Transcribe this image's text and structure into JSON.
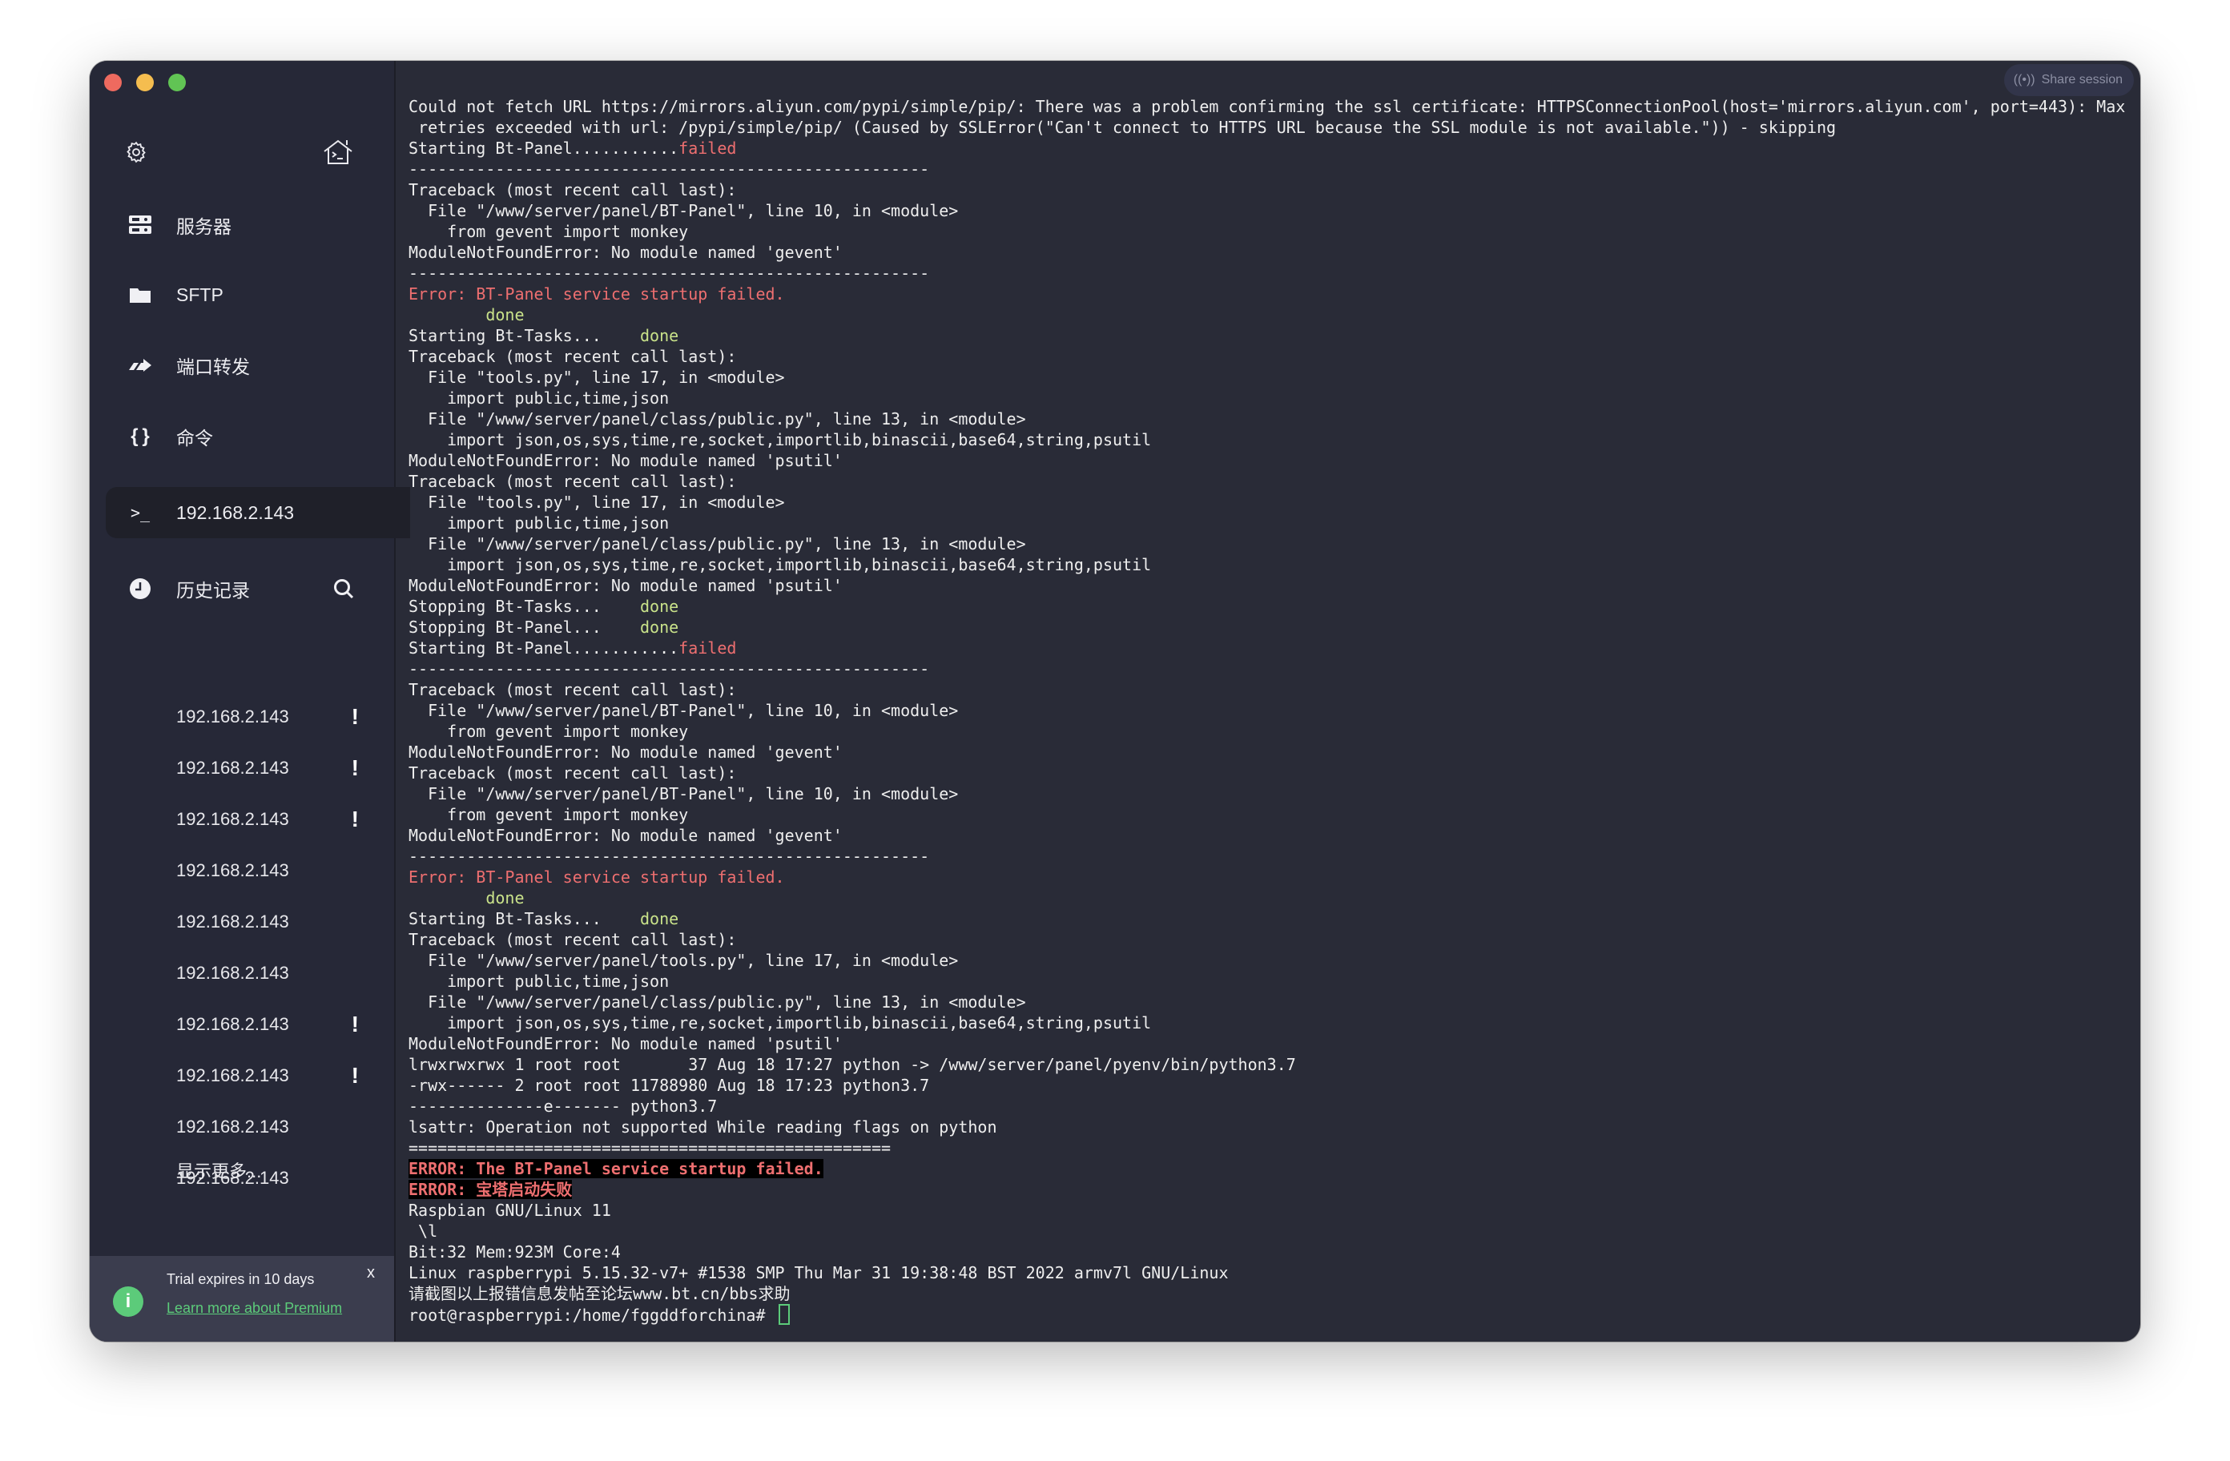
{
  "sidebar": {
    "nav": [
      {
        "label": "服务器",
        "icon": "server-icon"
      },
      {
        "label": "SFTP",
        "icon": "folder-icon"
      },
      {
        "label": "端口转发",
        "icon": "port-forward-icon"
      },
      {
        "label": "命令",
        "icon": "braces-icon"
      }
    ],
    "active_session": {
      "label": "192.168.2.143",
      "icon": "terminal-prompt-icon"
    },
    "history_label": "历史记录",
    "history": [
      {
        "label": "192.168.2.143",
        "warning": "!"
      },
      {
        "label": "192.168.2.143",
        "warning": "!"
      },
      {
        "label": "192.168.2.143",
        "warning": "!"
      },
      {
        "label": "192.168.2.143",
        "warning": ""
      },
      {
        "label": "192.168.2.143",
        "warning": ""
      },
      {
        "label": "192.168.2.143",
        "warning": ""
      },
      {
        "label": "192.168.2.143",
        "warning": "!"
      },
      {
        "label": "192.168.2.143",
        "warning": "!"
      },
      {
        "label": "192.168.2.143",
        "warning": ""
      },
      {
        "label": "192.168.2.143",
        "warning": ""
      }
    ],
    "show_more": "显示更多...",
    "trial": {
      "text": "Trial expires in 10 days",
      "link": "Learn more about Premium",
      "close": "x",
      "info": "i"
    }
  },
  "header": {
    "share_session": "Share session"
  },
  "colors": {
    "failed": "#ee6f70",
    "done": "#c9e28a",
    "accent": "#5ccb7a"
  },
  "terminal": {
    "lines": [
      [
        {
          "t": "Could not fetch URL https://mirrors.aliyun.com/pypi/simple/pip/: There was a problem confirming the ssl certificate: HTTPSConnectionPool(host='mirrors.aliyun.com', port=443): Max"
        }
      ],
      [
        {
          "t": " retries exceeded with url: /pypi/simple/pip/ (Caused by SSLError(\"Can't connect to HTTPS URL because the SSL module is not available.\")) - skipping"
        }
      ],
      [
        {
          "t": "Starting Bt-Panel..........."
        },
        {
          "t": "failed",
          "s": "red"
        }
      ],
      [
        {
          "t": "------------------------------------------------------"
        }
      ],
      [
        {
          "t": "Traceback (most recent call last):"
        }
      ],
      [
        {
          "t": "  File \"/www/server/panel/BT-Panel\", line 10, in <module>"
        }
      ],
      [
        {
          "t": "    from gevent import monkey"
        }
      ],
      [
        {
          "t": "ModuleNotFoundError: No module named 'gevent'"
        }
      ],
      [
        {
          "t": "------------------------------------------------------"
        }
      ],
      [
        {
          "t": "Error: BT-Panel service startup failed.",
          "s": "red"
        }
      ],
      [
        {
          "t": "        "
        },
        {
          "t": "done",
          "s": "green"
        }
      ],
      [
        {
          "t": "Starting Bt-Tasks...    "
        },
        {
          "t": "done",
          "s": "green"
        }
      ],
      [
        {
          "t": "Traceback (most recent call last):"
        }
      ],
      [
        {
          "t": "  File \"tools.py\", line 17, in <module>"
        }
      ],
      [
        {
          "t": "    import public,time,json"
        }
      ],
      [
        {
          "t": "  File \"/www/server/panel/class/public.py\", line 13, in <module>"
        }
      ],
      [
        {
          "t": "    import json,os,sys,time,re,socket,importlib,binascii,base64,string,psutil"
        }
      ],
      [
        {
          "t": "ModuleNotFoundError: No module named 'psutil'"
        }
      ],
      [
        {
          "t": "Traceback (most recent call last):"
        }
      ],
      [
        {
          "t": "  File \"tools.py\", line 17, in <module>"
        }
      ],
      [
        {
          "t": "    import public,time,json"
        }
      ],
      [
        {
          "t": "  File \"/www/server/panel/class/public.py\", line 13, in <module>"
        }
      ],
      [
        {
          "t": "    import json,os,sys,time,re,socket,importlib,binascii,base64,string,psutil"
        }
      ],
      [
        {
          "t": "ModuleNotFoundError: No module named 'psutil'"
        }
      ],
      [
        {
          "t": "Stopping Bt-Tasks...    "
        },
        {
          "t": "done",
          "s": "green"
        }
      ],
      [
        {
          "t": "Stopping Bt-Panel...    "
        },
        {
          "t": "done",
          "s": "green"
        }
      ],
      [
        {
          "t": "Starting Bt-Panel..........."
        },
        {
          "t": "failed",
          "s": "red"
        }
      ],
      [
        {
          "t": "------------------------------------------------------"
        }
      ],
      [
        {
          "t": "Traceback (most recent call last):"
        }
      ],
      [
        {
          "t": "  File \"/www/server/panel/BT-Panel\", line 10, in <module>"
        }
      ],
      [
        {
          "t": "    from gevent import monkey"
        }
      ],
      [
        {
          "t": "ModuleNotFoundError: No module named 'gevent'"
        }
      ],
      [
        {
          "t": "Traceback (most recent call last):"
        }
      ],
      [
        {
          "t": "  File \"/www/server/panel/BT-Panel\", line 10, in <module>"
        }
      ],
      [
        {
          "t": "    from gevent import monkey"
        }
      ],
      [
        {
          "t": "ModuleNotFoundError: No module named 'gevent'"
        }
      ],
      [
        {
          "t": "------------------------------------------------------"
        }
      ],
      [
        {
          "t": "Error: BT-Panel service startup failed.",
          "s": "red"
        }
      ],
      [
        {
          "t": "        "
        },
        {
          "t": "done",
          "s": "green"
        }
      ],
      [
        {
          "t": "Starting Bt-Tasks...    "
        },
        {
          "t": "done",
          "s": "green"
        }
      ],
      [
        {
          "t": "Traceback (most recent call last):"
        }
      ],
      [
        {
          "t": "  File \"/www/server/panel/tools.py\", line 17, in <module>"
        }
      ],
      [
        {
          "t": "    import public,time,json"
        }
      ],
      [
        {
          "t": "  File \"/www/server/panel/class/public.py\", line 13, in <module>"
        }
      ],
      [
        {
          "t": "    import json,os,sys,time,re,socket,importlib,binascii,base64,string,psutil"
        }
      ],
      [
        {
          "t": "ModuleNotFoundError: No module named 'psutil'"
        }
      ],
      [
        {
          "t": "lrwxrwxrwx 1 root root       37 Aug 18 17:27 python -> /www/server/panel/pyenv/bin/python3.7"
        }
      ],
      [
        {
          "t": "-rwx------ 2 root root 11788980 Aug 18 17:23 python3.7"
        }
      ],
      [
        {
          "t": "--------------e------- python3.7"
        }
      ],
      [
        {
          "t": "lsattr: Operation not supported While reading flags on python"
        }
      ],
      [
        {
          "t": "=================================================="
        }
      ],
      [
        {
          "t": "ERROR: The BT-Panel service startup failed.",
          "s": "err"
        }
      ],
      [
        {
          "t": "ERROR: 宝塔启动失败",
          "s": "err"
        }
      ],
      [
        {
          "t": "Raspbian GNU/Linux 11"
        }
      ],
      [
        {
          "t": " \\l"
        }
      ],
      [
        {
          "t": "Bit:32 Mem:923M Core:4"
        }
      ],
      [
        {
          "t": "Linux raspberrypi 5.15.32-v7+ #1538 SMP Thu Mar 31 19:38:48 BST 2022 armv7l GNU/Linux"
        }
      ],
      [
        {
          "t": "请截图以上报错信息发帖至论坛www.bt.cn/bbs求助"
        }
      ],
      [
        {
          "t": "root@raspberrypi:/home/fggddforchina# "
        }
      ]
    ]
  }
}
